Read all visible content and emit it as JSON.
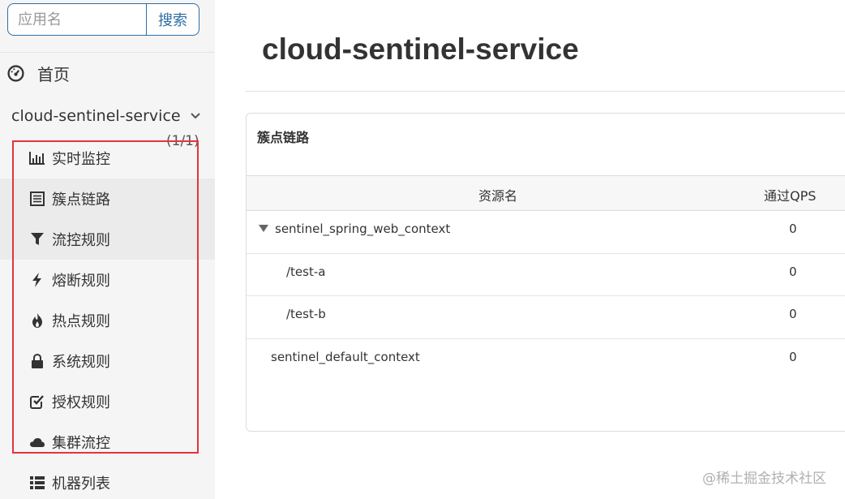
{
  "search": {
    "placeholder": "应用名",
    "button": "搜索"
  },
  "nav": {
    "home": "首页",
    "app_name": "cloud-sentinel-service",
    "app_count": "(1/1)",
    "items": [
      {
        "label": "实时监控",
        "icon": "bar-chart-icon"
      },
      {
        "label": "簇点链路",
        "icon": "list-icon"
      },
      {
        "label": "流控规则",
        "icon": "filter-icon"
      },
      {
        "label": "熔断规则",
        "icon": "bolt-icon"
      },
      {
        "label": "热点规则",
        "icon": "fire-icon"
      },
      {
        "label": "系统规则",
        "icon": "lock-icon"
      },
      {
        "label": "授权规则",
        "icon": "check-square-icon"
      },
      {
        "label": "集群流控",
        "icon": "cloud-icon"
      }
    ],
    "machine_list": "机器列表"
  },
  "page": {
    "title": "cloud-sentinel-service"
  },
  "panel": {
    "title": "簇点链路",
    "columns": {
      "resource": "资源名",
      "qps": "通过QPS"
    },
    "rows": [
      {
        "name": "sentinel_spring_web_context",
        "qps": "0"
      },
      {
        "name": "/test-a",
        "qps": "0"
      },
      {
        "name": "/test-b",
        "qps": "0"
      },
      {
        "name": "sentinel_default_context",
        "qps": "0"
      }
    ]
  },
  "watermark": "@稀土掘金技术社区",
  "colors": {
    "accent": "#2e6da4",
    "highlight": "#e5343a"
  }
}
